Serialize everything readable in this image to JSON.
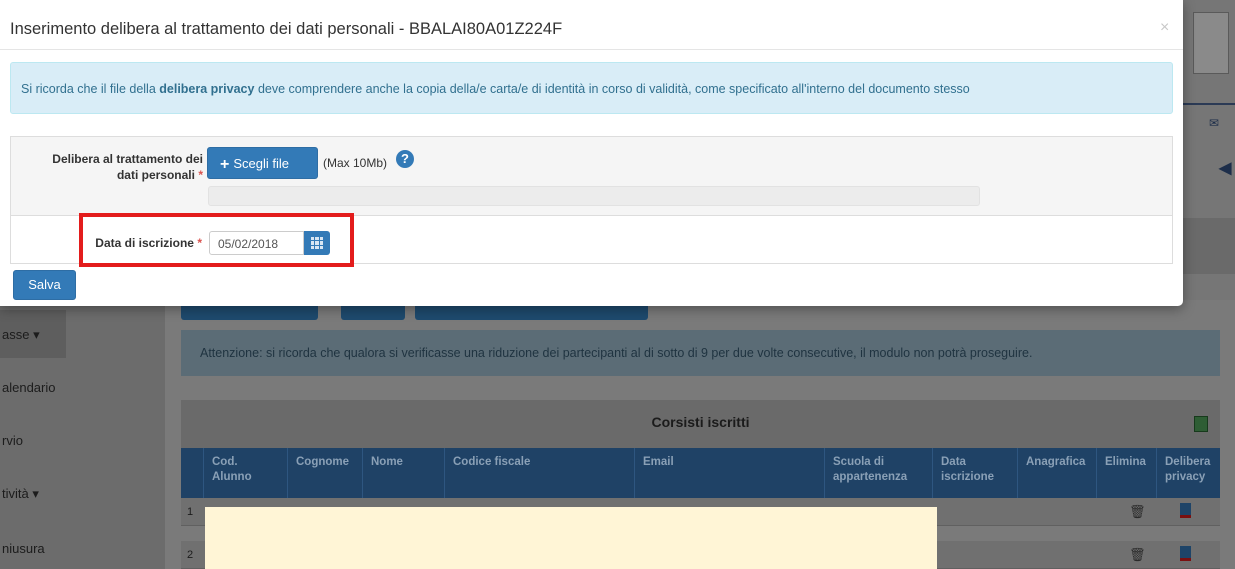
{
  "modal": {
    "title": "Inserimento delibera al trattamento dei dati personali - BBALAI80A01Z224F",
    "close_symbol": "×",
    "info_prefix": "Si ricorda che il file della ",
    "info_bold": "delibera privacy",
    "info_suffix": " deve comprendere anche la copia della/e carta/e di identità in corso di validità, come specificato all'interno del documento stesso",
    "delibera_label_line1": "Delibera al trattamento dei",
    "delibera_label_line2": "dati personali",
    "required_mark": "*",
    "choose_file_label": "Scegli file",
    "max_size": "(Max 10Mb)",
    "help_symbol": "?",
    "date_label": "Data di iscrizione",
    "date_value": "05/02/2018",
    "save_label": "Salva"
  },
  "background": {
    "sidebar_items": [
      "asse ▾",
      "alendario",
      "rvio",
      "tività ▾",
      "niusura"
    ],
    "alert_text": "Attenzione: si ricorda che qualora si verificasse una riduzione dei partecipanti al di sotto di 9 per due volte consecutive, il modulo non potrà proseguire.",
    "panel_title": "Corsisti iscritti",
    "table_headers": [
      [
        "Cod.",
        "Alunno"
      ],
      [
        "Cognome",
        ""
      ],
      [
        "Nome",
        ""
      ],
      [
        "Codice fiscale",
        ""
      ],
      [
        "Email",
        ""
      ],
      [
        "Scuola di",
        "appartenenza"
      ],
      [
        "Data",
        "iscrizione"
      ],
      [
        "Anagrafica",
        ""
      ],
      [
        "Elimina",
        ""
      ],
      [
        "Delibera",
        "privacy"
      ]
    ],
    "rows": [
      "1",
      "2"
    ]
  },
  "colors": {
    "primary": "#337ab7",
    "info_bg": "#d9edf7",
    "highlight": "#e31c1c"
  },
  "icons": [
    "close-icon",
    "plus-icon",
    "help-icon",
    "calendar-icon",
    "mail-icon",
    "back-arrow-icon",
    "excel-icon",
    "trash-icon",
    "document-icon"
  ]
}
